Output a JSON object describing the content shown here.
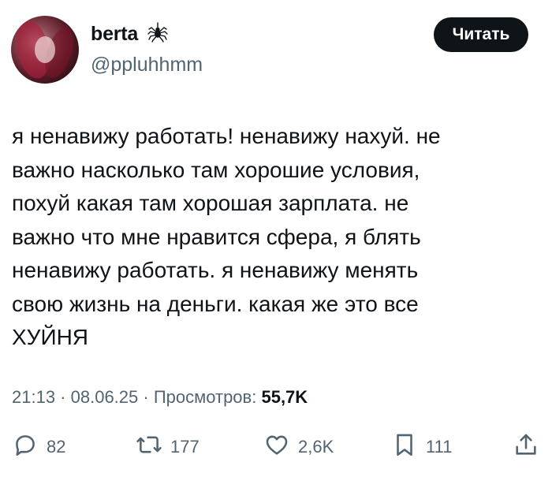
{
  "author": {
    "name": "berta",
    "handle": "@ppluhhmm",
    "avatar_icon": "avatar-photo",
    "badge_icon": "spider-icon"
  },
  "header": {
    "read_button_label": "Читать"
  },
  "tweet": {
    "lines": [
      "я ненавижу работать! ненавижу нахуй. не",
      "важно насколько там хорошие условия,",
      "похуй какая там хорошая зарплата. не",
      "важно что мне нравится сфера, я блять",
      "ненавижу работать. я ненавижу менять",
      "свою жизнь на деньги. какая же это все",
      "ХУЙНЯ"
    ]
  },
  "meta": {
    "time": "21:13",
    "separator": " · ",
    "date": "08.06.25",
    "views_label": "Просмотров:",
    "views_count": "55,7K"
  },
  "actions": {
    "replies": "82",
    "reposts": "177",
    "likes": "2,6K",
    "bookmarks": "111"
  },
  "colors": {
    "text": "#0f1419",
    "secondary": "#536471",
    "button_bg": "#0f1419",
    "button_text": "#ffffff",
    "background": "#ffffff"
  }
}
